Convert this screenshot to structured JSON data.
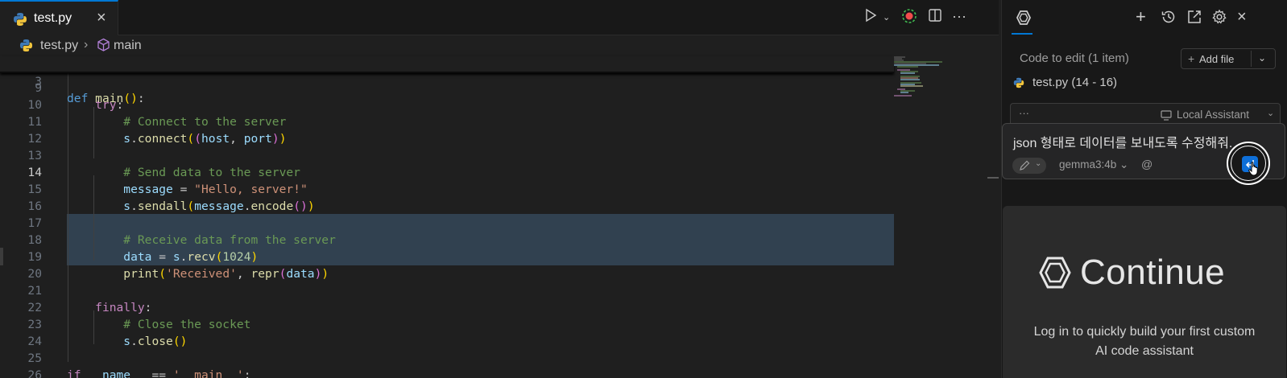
{
  "editor": {
    "tab_label": "test.py",
    "breadcrumb_file": "test.py",
    "breadcrumb_sep": "›",
    "breadcrumb_symbol": "main",
    "run_icon": "play-icon",
    "lines": [
      {
        "n": "3",
        "html": "<span class='kwd'>def</span> <span class='fn'>main</span><span class='p1'>()</span>:"
      },
      {
        "n": "9",
        "html": ""
      },
      {
        "n": "10",
        "html": "    <span class='kw'>try</span>:"
      },
      {
        "n": "11",
        "html": "        <span class='cm'># Connect to the server</span>"
      },
      {
        "n": "12",
        "html": "        <span class='vr'>s</span>.<span class='fn'>connect</span><span class='p1'>(</span><span class='p2'>(</span><span class='vr'>host</span>, <span class='vr'>port</span><span class='p2'>)</span><span class='p1'>)</span>"
      },
      {
        "n": "13",
        "html": ""
      },
      {
        "n": "14",
        "html": "        <span class='cm'># Send data to the server</span>"
      },
      {
        "n": "15",
        "html": "        <span class='vr'>message</span> = <span class='st'>\"Hello, server!\"</span>"
      },
      {
        "n": "16",
        "html": "        <span class='vr'>s</span>.<span class='fn'>sendall</span><span class='p1'>(</span><span class='vr'>message</span>.<span class='fn'>encode</span><span class='p2'>()</span><span class='p1'>)</span>"
      },
      {
        "n": "17",
        "html": ""
      },
      {
        "n": "18",
        "html": "        <span class='cm'># Receive data from the server</span>"
      },
      {
        "n": "19",
        "html": "        <span class='vr'>data</span> = <span class='vr'>s</span>.<span class='fn'>recv</span><span class='p1'>(</span><span class='nm'>1024</span><span class='p1'>)</span>"
      },
      {
        "n": "20",
        "html": "        <span class='fn'>print</span><span class='p1'>(</span><span class='st'>'Received'</span>, <span class='fn'>repr</span><span class='p2'>(</span><span class='vr'>data</span><span class='p2'>)</span><span class='p1'>)</span>"
      },
      {
        "n": "21",
        "html": ""
      },
      {
        "n": "22",
        "html": "    <span class='kw'>finally</span>:"
      },
      {
        "n": "23",
        "html": "        <span class='cm'># Close the socket</span>"
      },
      {
        "n": "24",
        "html": "        <span class='vr'>s</span>.<span class='fn'>close</span><span class='p1'>()</span>"
      },
      {
        "n": "25",
        "html": ""
      },
      {
        "n": "26",
        "html": "<span class='kw'>if</span> <span class='vr'>__name__</span> == <span class='st'>'__main__'</span>:"
      }
    ],
    "active_line": "14"
  },
  "panel": {
    "code_to_edit_title": "Code to edit (1 item)",
    "add_file_label": "Add file",
    "file_item": "test.py (14 - 16)",
    "assistant_dots": "···",
    "assistant_label": "Local Assistant",
    "input_text": "json 형태로 데이터를 보내도록 수정해줘.",
    "model_label": "gemma3:4b",
    "at_label": "@",
    "promo_brand": "Continue",
    "promo_text": "Log in to quickly build your first custom AI code assistant"
  },
  "colors": {
    "accent": "#0078d4",
    "send_button": "#0e6fd8",
    "selection": "#314150"
  }
}
